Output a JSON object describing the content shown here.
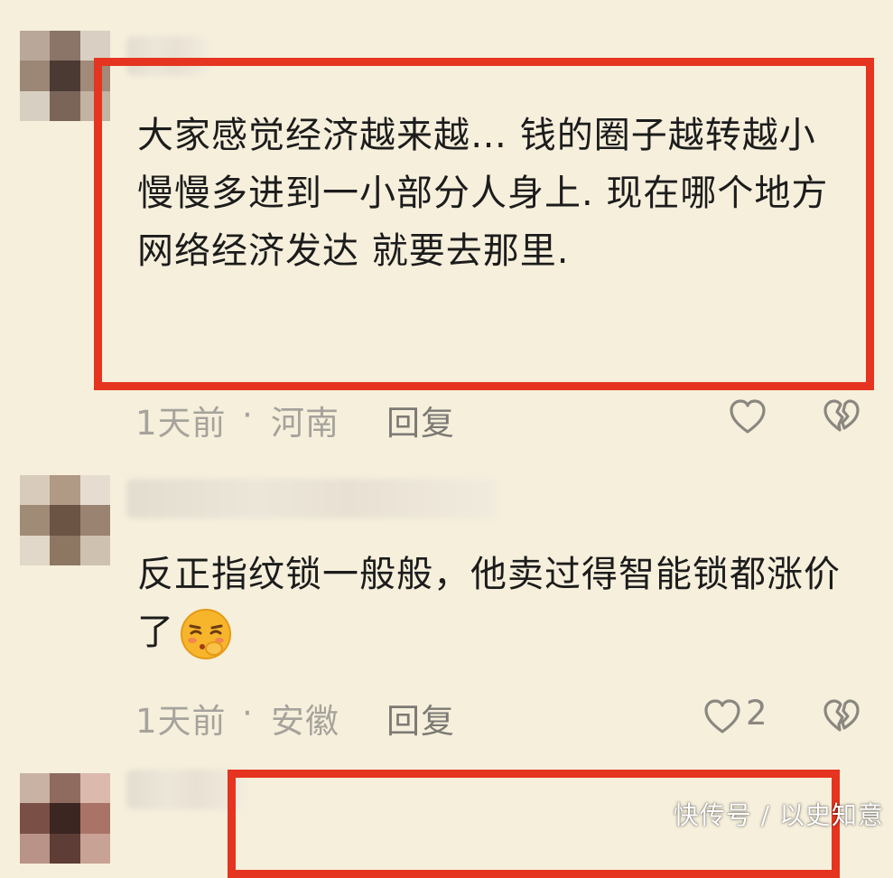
{
  "comments": [
    {
      "text": "大家感觉经济越来越… 钱的圈子越转越小 慢慢多进到一小部分人身上. 现在哪个地方网络经济发达 就要去那里.",
      "time": "1天前",
      "location": "河南",
      "reply_label": "回复",
      "likes": ""
    },
    {
      "text": "反正指纹锁一般般，他卖过得智能锁都涨价了",
      "time": "1天前",
      "location": "安徽",
      "reply_label": "回复",
      "likes": "2"
    }
  ],
  "separator": "·",
  "watermark": "快传号 / 以史知意",
  "colors": {
    "background": "#f6efdc",
    "highlight": "#e5341f",
    "meta_text": "#a6a39c"
  },
  "icons": [
    "heart-icon",
    "broken-heart-icon",
    "shy-face-emoji"
  ]
}
